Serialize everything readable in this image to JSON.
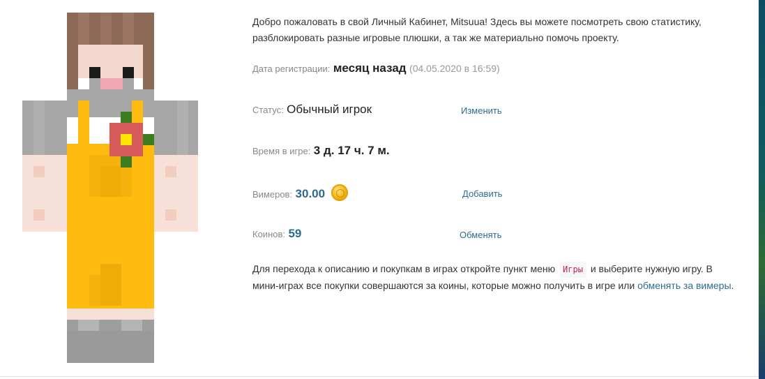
{
  "profile": {
    "welcome_text": "Добро пожаловать в свой Личный Кабинет, Mitsuua! Здесь вы можете посмотреть свою статистику, разблокировать разные игровые плюшки, а так же материально помочь проекту.",
    "registration": {
      "label": "Дата регистрации:",
      "value": "месяц назад",
      "date": "(04.05.2020 в 16:59)"
    },
    "status": {
      "label": "Статус:",
      "value": "Обычный игрок",
      "action": "Изменить"
    },
    "playtime": {
      "label": "Время в игре:",
      "value": "3 д. 17 ч. 7 м."
    },
    "vimers": {
      "label": "Вимеров:",
      "value": "30.00",
      "icon": "coin-icon",
      "action": "Добавить"
    },
    "coins": {
      "label": "Коинов:",
      "value": "59",
      "action": "Обменять"
    },
    "footer": {
      "text_before": "Для перехода к описанию и покупкам в играх откройте пункт меню",
      "menu_item": "Игры",
      "text_after": "и выберите нужную игру. В мини-играх все покупки совершаются за коины, которые можно получить в игре или",
      "link": "обменять за вимеры",
      "text_end": "."
    }
  },
  "colors": {
    "accent": "#2d6b8e",
    "label": "#888888",
    "overall": "#ffbb0e",
    "shirt": "#9e9e9e",
    "hair": "#8d6a57"
  }
}
